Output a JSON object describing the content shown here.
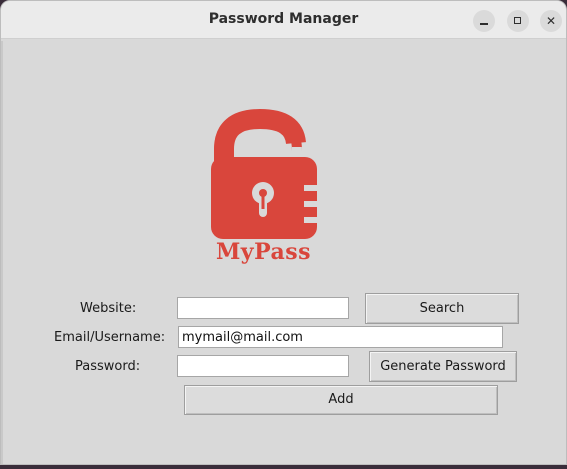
{
  "window": {
    "title": "Password Manager"
  },
  "logo": {
    "icon": "padlock-open-icon",
    "brand_text": "MyPass",
    "color": "#d9463c"
  },
  "form": {
    "website_label": "Website:",
    "website_value": "",
    "email_label": "Email/Username:",
    "email_value": "mymail@mail.com",
    "password_label": "Password:",
    "password_value": ""
  },
  "buttons": {
    "search": "Search",
    "generate": "Generate Password",
    "add": "Add"
  }
}
